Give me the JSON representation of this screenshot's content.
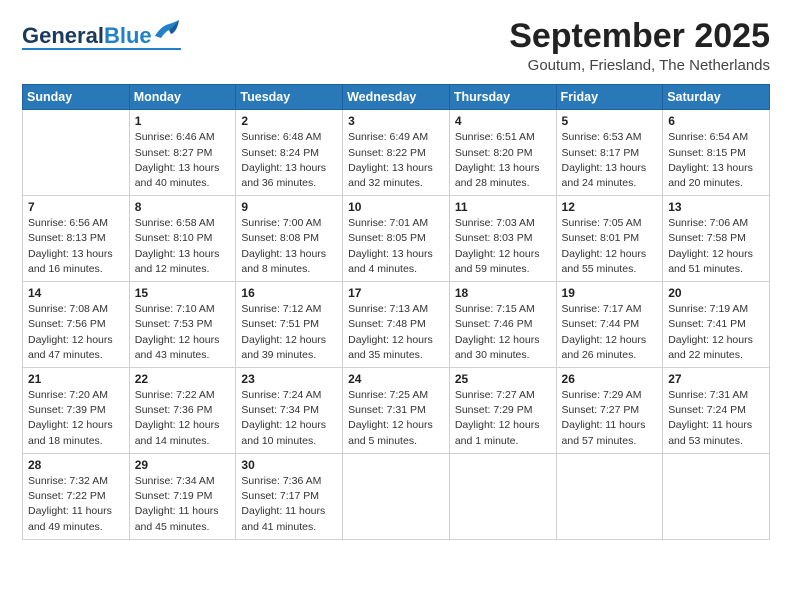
{
  "header": {
    "logo_general": "General",
    "logo_blue": "Blue",
    "month_title": "September 2025",
    "location": "Goutum, Friesland, The Netherlands"
  },
  "days_of_week": [
    "Sunday",
    "Monday",
    "Tuesday",
    "Wednesday",
    "Thursday",
    "Friday",
    "Saturday"
  ],
  "weeks": [
    [
      {
        "day": "",
        "info": ""
      },
      {
        "day": "1",
        "info": "Sunrise: 6:46 AM\nSunset: 8:27 PM\nDaylight: 13 hours\nand 40 minutes."
      },
      {
        "day": "2",
        "info": "Sunrise: 6:48 AM\nSunset: 8:24 PM\nDaylight: 13 hours\nand 36 minutes."
      },
      {
        "day": "3",
        "info": "Sunrise: 6:49 AM\nSunset: 8:22 PM\nDaylight: 13 hours\nand 32 minutes."
      },
      {
        "day": "4",
        "info": "Sunrise: 6:51 AM\nSunset: 8:20 PM\nDaylight: 13 hours\nand 28 minutes."
      },
      {
        "day": "5",
        "info": "Sunrise: 6:53 AM\nSunset: 8:17 PM\nDaylight: 13 hours\nand 24 minutes."
      },
      {
        "day": "6",
        "info": "Sunrise: 6:54 AM\nSunset: 8:15 PM\nDaylight: 13 hours\nand 20 minutes."
      }
    ],
    [
      {
        "day": "7",
        "info": "Sunrise: 6:56 AM\nSunset: 8:13 PM\nDaylight: 13 hours\nand 16 minutes."
      },
      {
        "day": "8",
        "info": "Sunrise: 6:58 AM\nSunset: 8:10 PM\nDaylight: 13 hours\nand 12 minutes."
      },
      {
        "day": "9",
        "info": "Sunrise: 7:00 AM\nSunset: 8:08 PM\nDaylight: 13 hours\nand 8 minutes."
      },
      {
        "day": "10",
        "info": "Sunrise: 7:01 AM\nSunset: 8:05 PM\nDaylight: 13 hours\nand 4 minutes."
      },
      {
        "day": "11",
        "info": "Sunrise: 7:03 AM\nSunset: 8:03 PM\nDaylight: 12 hours\nand 59 minutes."
      },
      {
        "day": "12",
        "info": "Sunrise: 7:05 AM\nSunset: 8:01 PM\nDaylight: 12 hours\nand 55 minutes."
      },
      {
        "day": "13",
        "info": "Sunrise: 7:06 AM\nSunset: 7:58 PM\nDaylight: 12 hours\nand 51 minutes."
      }
    ],
    [
      {
        "day": "14",
        "info": "Sunrise: 7:08 AM\nSunset: 7:56 PM\nDaylight: 12 hours\nand 47 minutes."
      },
      {
        "day": "15",
        "info": "Sunrise: 7:10 AM\nSunset: 7:53 PM\nDaylight: 12 hours\nand 43 minutes."
      },
      {
        "day": "16",
        "info": "Sunrise: 7:12 AM\nSunset: 7:51 PM\nDaylight: 12 hours\nand 39 minutes."
      },
      {
        "day": "17",
        "info": "Sunrise: 7:13 AM\nSunset: 7:48 PM\nDaylight: 12 hours\nand 35 minutes."
      },
      {
        "day": "18",
        "info": "Sunrise: 7:15 AM\nSunset: 7:46 PM\nDaylight: 12 hours\nand 30 minutes."
      },
      {
        "day": "19",
        "info": "Sunrise: 7:17 AM\nSunset: 7:44 PM\nDaylight: 12 hours\nand 26 minutes."
      },
      {
        "day": "20",
        "info": "Sunrise: 7:19 AM\nSunset: 7:41 PM\nDaylight: 12 hours\nand 22 minutes."
      }
    ],
    [
      {
        "day": "21",
        "info": "Sunrise: 7:20 AM\nSunset: 7:39 PM\nDaylight: 12 hours\nand 18 minutes."
      },
      {
        "day": "22",
        "info": "Sunrise: 7:22 AM\nSunset: 7:36 PM\nDaylight: 12 hours\nand 14 minutes."
      },
      {
        "day": "23",
        "info": "Sunrise: 7:24 AM\nSunset: 7:34 PM\nDaylight: 12 hours\nand 10 minutes."
      },
      {
        "day": "24",
        "info": "Sunrise: 7:25 AM\nSunset: 7:31 PM\nDaylight: 12 hours\nand 5 minutes."
      },
      {
        "day": "25",
        "info": "Sunrise: 7:27 AM\nSunset: 7:29 PM\nDaylight: 12 hours\nand 1 minute."
      },
      {
        "day": "26",
        "info": "Sunrise: 7:29 AM\nSunset: 7:27 PM\nDaylight: 11 hours\nand 57 minutes."
      },
      {
        "day": "27",
        "info": "Sunrise: 7:31 AM\nSunset: 7:24 PM\nDaylight: 11 hours\nand 53 minutes."
      }
    ],
    [
      {
        "day": "28",
        "info": "Sunrise: 7:32 AM\nSunset: 7:22 PM\nDaylight: 11 hours\nand 49 minutes."
      },
      {
        "day": "29",
        "info": "Sunrise: 7:34 AM\nSunset: 7:19 PM\nDaylight: 11 hours\nand 45 minutes."
      },
      {
        "day": "30",
        "info": "Sunrise: 7:36 AM\nSunset: 7:17 PM\nDaylight: 11 hours\nand 41 minutes."
      },
      {
        "day": "",
        "info": ""
      },
      {
        "day": "",
        "info": ""
      },
      {
        "day": "",
        "info": ""
      },
      {
        "day": "",
        "info": ""
      }
    ]
  ]
}
